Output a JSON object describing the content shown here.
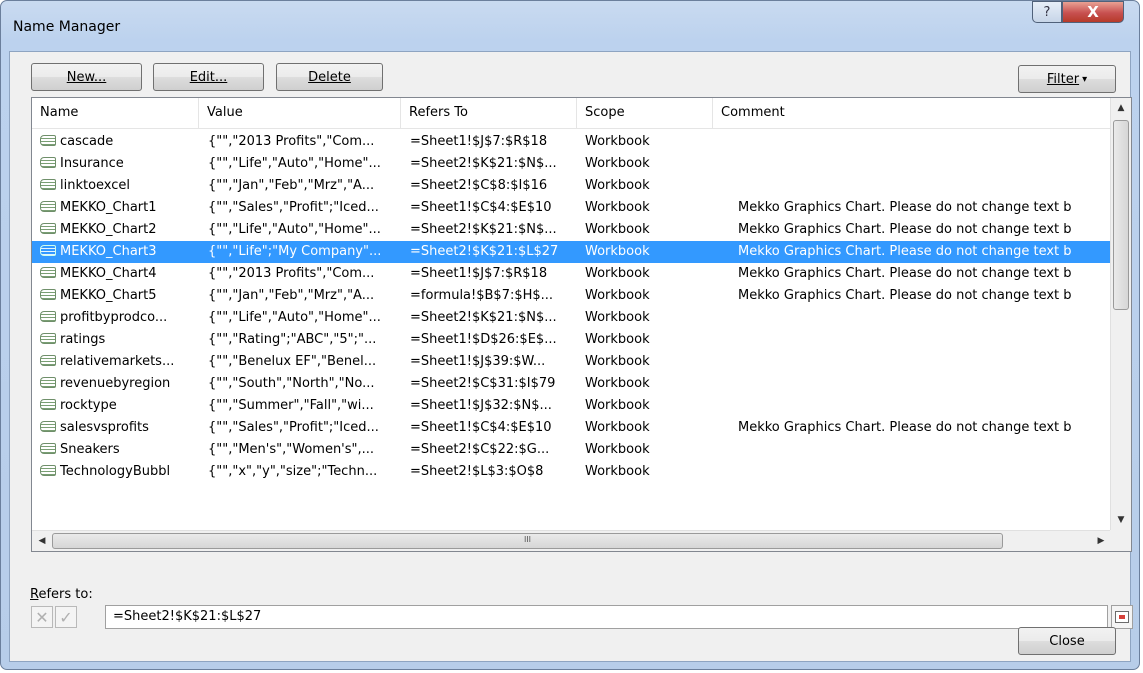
{
  "window": {
    "title": "Name Manager",
    "help_glyph": "?",
    "close_glyph": "X"
  },
  "toolbar": {
    "new_label": "New...",
    "edit_label": "Edit...",
    "delete_label": "Delete",
    "filter_label": "Filter",
    "filter_arrow": "▾"
  },
  "columns": [
    "Name",
    "Value",
    "Refers To",
    "Scope",
    "Comment"
  ],
  "rows": [
    {
      "name": "cascade",
      "value": "{\"\",\"2013 Profits\",\"Com...",
      "refers": "=Sheet1!$J$7:$R$18",
      "scope": "Workbook",
      "comment": ""
    },
    {
      "name": "Insurance",
      "value": "{\"\",\"Life\",\"Auto\",\"Home\"...",
      "refers": "=Sheet2!$K$21:$N$...",
      "scope": "Workbook",
      "comment": ""
    },
    {
      "name": "linktoexcel",
      "value": "{\"\",\"Jan\",\"Feb\",\"Mrz\",\"A...",
      "refers": "=Sheet2!$C$8:$I$16",
      "scope": "Workbook",
      "comment": ""
    },
    {
      "name": "MEKKO_Chart1",
      "value": "{\"\",\"Sales\",\"Profit\";\"Iced...",
      "refers": "=Sheet1!$C$4:$E$10",
      "scope": "Workbook",
      "comment": "Mekko Graphics Chart. Please do not change text b"
    },
    {
      "name": "MEKKO_Chart2",
      "value": "{\"\",\"Life\",\"Auto\",\"Home\"...",
      "refers": "=Sheet2!$K$21:$N$...",
      "scope": "Workbook",
      "comment": "Mekko Graphics Chart. Please do not change text b"
    },
    {
      "name": "MEKKO_Chart3",
      "value": "{\"\",\"Life\";\"My Company\"...",
      "refers": "=Sheet2!$K$21:$L$27",
      "scope": "Workbook",
      "comment": "Mekko Graphics Chart. Please do not change text b"
    },
    {
      "name": "MEKKO_Chart4",
      "value": "{\"\",\"2013 Profits\",\"Com...",
      "refers": "=Sheet1!$J$7:$R$18",
      "scope": "Workbook",
      "comment": "Mekko Graphics Chart. Please do not change text b"
    },
    {
      "name": "MEKKO_Chart5",
      "value": "{\"\",\"Jan\",\"Feb\",\"Mrz\",\"A...",
      "refers": "=formula!$B$7:$H$...",
      "scope": "Workbook",
      "comment": "Mekko Graphics Chart. Please do not change text b"
    },
    {
      "name": "profitbyprodco...",
      "value": "{\"\",\"Life\",\"Auto\",\"Home\"...",
      "refers": "=Sheet2!$K$21:$N$...",
      "scope": "Workbook",
      "comment": ""
    },
    {
      "name": "ratings",
      "value": "{\"\",\"Rating\";\"ABC\",\"5\";\"...",
      "refers": "=Sheet1!$D$26:$E$...",
      "scope": "Workbook",
      "comment": ""
    },
    {
      "name": "relativemarkets...",
      "value": "{\"\",\"Benelux EF\",\"Benel...",
      "refers": "=Sheet1!$J$39:$W...",
      "scope": "Workbook",
      "comment": ""
    },
    {
      "name": "revenuebyregion",
      "value": "{\"\",\"South\",\"North\",\"No...",
      "refers": "=Sheet2!$C$31:$I$79",
      "scope": "Workbook",
      "comment": ""
    },
    {
      "name": "rocktype",
      "value": "{\"\",\"Summer\",\"Fall\",\"wi...",
      "refers": "=Sheet1!$J$32:$N$...",
      "scope": "Workbook",
      "comment": ""
    },
    {
      "name": "salesvsprofits",
      "value": "{\"\",\"Sales\",\"Profit\";\"Iced...",
      "refers": "=Sheet1!$C$4:$E$10",
      "scope": "Workbook",
      "comment": "Mekko Graphics Chart. Please do not change text b"
    },
    {
      "name": "Sneakers",
      "value": "{\"\",\"Men's\",\"Women's\",...",
      "refers": "=Sheet2!$C$22:$G...",
      "scope": "Workbook",
      "comment": ""
    },
    {
      "name": "TechnologyBubbl",
      "value": "{\"\",\"x\",\"y\",\"size\";\"Techn...",
      "refers": "=Sheet2!$L$3:$O$8",
      "scope": "Workbook",
      "comment": ""
    }
  ],
  "selected_row": 5,
  "scrollbar": {
    "up": "▲",
    "down": "▼",
    "left": "◀",
    "right": "▶",
    "grip": "III"
  },
  "refers_to": {
    "label_first": "R",
    "label_rest": "efers to:",
    "value": "=Sheet2!$K$21:$L$27"
  },
  "footer": {
    "close_label": "Close"
  },
  "colors": {
    "selection": "#3399ff",
    "title_bar": "#bcd2ee",
    "close_button": "#c75050"
  }
}
